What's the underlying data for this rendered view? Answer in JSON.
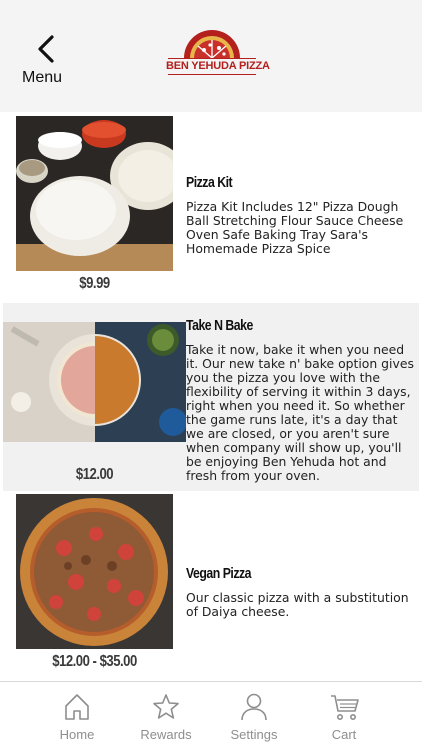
{
  "header": {
    "menu_label": "Menu",
    "logo_text": "BEN YEHUDA PIZZA",
    "brand_color": "#b3201e"
  },
  "items": [
    {
      "name": "Pizza Kit",
      "price": "$9.99",
      "description": "Pizza Kit Includes 12\" Pizza Dough Ball Stretching Flour Sauce Cheese Oven Safe Baking Tray Sara's Homemade Pizza Spice"
    },
    {
      "name": "Take N Bake",
      "price": "$12.00",
      "description": "Take it now, bake it when you need it. Our new take n' bake option gives you the pizza you love with the flexibility of serving it within 3 days, right when you need it.  So whether the game runs late, it's a day that we are closed, or you aren't sure when company will show up, you'll be enjoying Ben Yehuda hot and fresh from your oven."
    },
    {
      "name": "Vegan Pizza",
      "price": "$12.00 - $35.00",
      "description": "Our classic pizza with a substitution of Daiya cheese."
    }
  ],
  "tabs": [
    {
      "label": "Home",
      "icon": "home-icon"
    },
    {
      "label": "Rewards",
      "icon": "star-icon"
    },
    {
      "label": "Settings",
      "icon": "person-icon"
    },
    {
      "label": "Cart",
      "icon": "cart-icon"
    }
  ]
}
